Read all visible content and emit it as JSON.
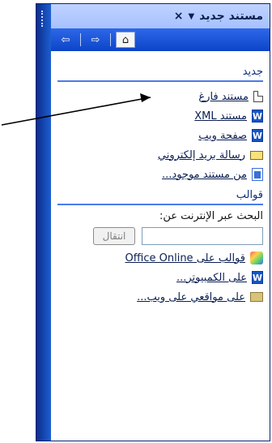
{
  "pane": {
    "title": "مستند جديد",
    "nav": {
      "back_icon": "back-arrow-icon",
      "forward_icon": "forward-arrow-icon",
      "home_icon": "home-icon"
    }
  },
  "new_section": {
    "title": "جديد",
    "items": [
      {
        "label": "مستند فارغ",
        "icon": "blank-document-icon"
      },
      {
        "label": "مستند XML",
        "icon": "xml-document-icon"
      },
      {
        "label": "صفحة ويب",
        "icon": "web-page-icon"
      },
      {
        "label": "رسالة بريد إلكتروني",
        "icon": "email-icon"
      },
      {
        "label": "من مستند موجود...",
        "icon": "existing-document-icon"
      }
    ]
  },
  "templates_section": {
    "title": "قوالب",
    "search_label": "البحث عبر الإنترنت عن:",
    "search": {
      "value": "",
      "placeholder": ""
    },
    "go_button": "انتقال",
    "items": [
      {
        "label": "قوالب على Office Online",
        "icon": "office-online-icon"
      },
      {
        "label": "على الكمبيوتر...",
        "icon": "computer-templates-icon"
      },
      {
        "label": "على مواقعي على ويب...",
        "icon": "web-sites-folder-icon"
      }
    ]
  }
}
